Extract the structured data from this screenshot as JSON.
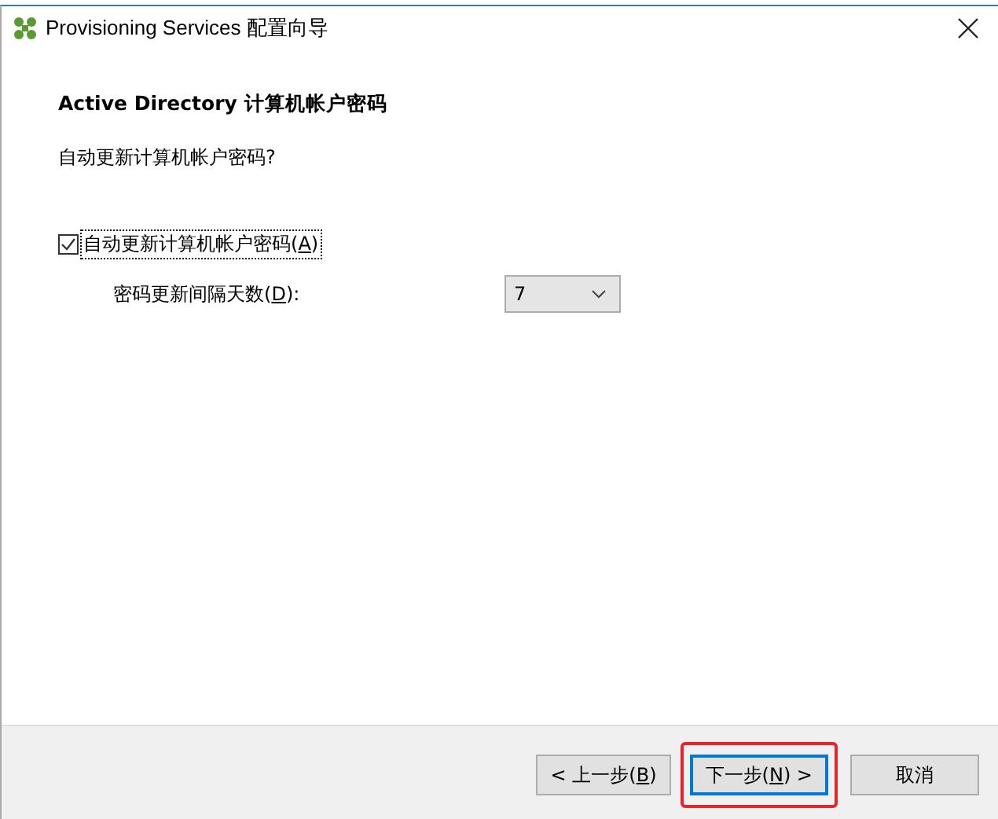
{
  "window": {
    "title": "Provisioning Services 配置向导"
  },
  "page": {
    "heading": "Active Directory 计算机帐户密码",
    "question": "自动更新计算机帐户密码?"
  },
  "auto_update": {
    "text": "自动更新计算机帐户密码(",
    "access_key": "A",
    "tail": ")",
    "checked": true
  },
  "interval": {
    "text": "密码更新间隔天数(",
    "access_key": "D",
    "tail": "):",
    "value": "7"
  },
  "buttons": [
    {
      "text": "< 上一步(",
      "access_key": "B",
      "tail": ")",
      "default": false,
      "highlighted": false
    },
    {
      "text": "下一步(",
      "access_key": "N",
      "tail": ") >",
      "default": true,
      "highlighted": true
    },
    {
      "text": "取消",
      "default": false,
      "highlighted": false
    }
  ]
}
